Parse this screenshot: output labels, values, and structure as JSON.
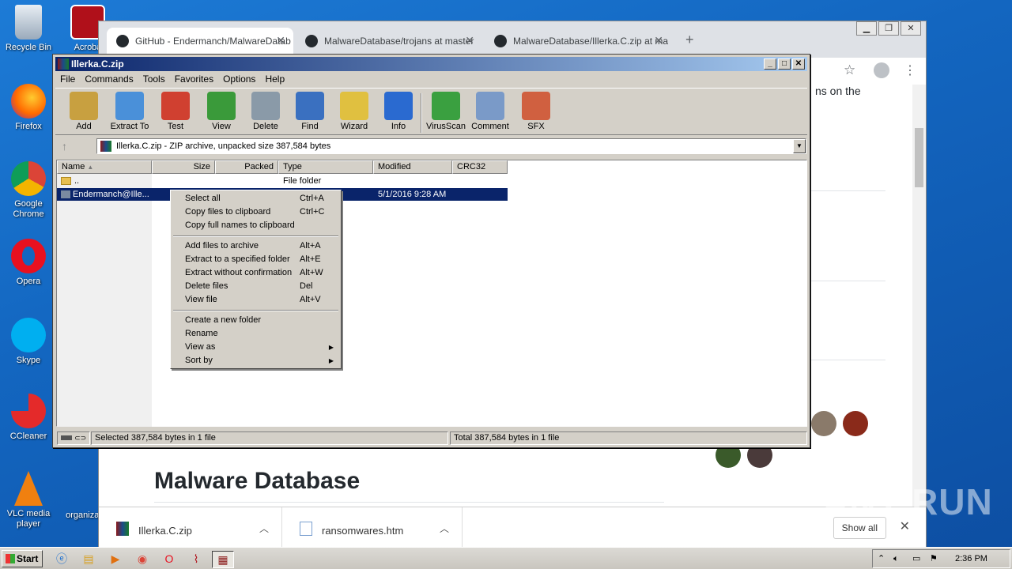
{
  "desktop": {
    "icons": [
      {
        "label": "Recycle Bin"
      },
      {
        "label": "Acroba"
      },
      {
        "label": "Firefox"
      },
      {
        "label": "Google Chrome"
      },
      {
        "label": "Opera"
      },
      {
        "label": "Skype"
      },
      {
        "label": "CCleaner"
      },
      {
        "label": "VLC media player"
      },
      {
        "label": "organizati"
      }
    ]
  },
  "chrome": {
    "tabs": [
      {
        "label": "GitHub - Endermanch/MalwareDatab"
      },
      {
        "label": "MalwareDatabase/trojans at master"
      },
      {
        "label": "MalwareDatabase/Illerka.C.zip at ma"
      }
    ],
    "page_heading": "Malware Database",
    "page_fragment": "ns on the",
    "downloads": [
      {
        "name": "Illerka.C.zip"
      },
      {
        "name": "ransomwares.htm"
      }
    ],
    "show_all": "Show all"
  },
  "winrar": {
    "title": "Illerka.C.zip",
    "menu": [
      "File",
      "Commands",
      "Tools",
      "Favorites",
      "Options",
      "Help"
    ],
    "toolbar": [
      {
        "label": "Add",
        "icon": "add-icon",
        "color": "#c8a040"
      },
      {
        "label": "Extract To",
        "icon": "extract-folder-icon",
        "color": "#4a90d9"
      },
      {
        "label": "Test",
        "icon": "test-checklist-icon",
        "color": "#d04030"
      },
      {
        "label": "View",
        "icon": "book-icon",
        "color": "#3a9a3a"
      },
      {
        "label": "Delete",
        "icon": "trash-icon",
        "color": "#8a9aa8"
      },
      {
        "label": "Find",
        "icon": "magnifier-icon",
        "color": "#3a70c0"
      },
      {
        "label": "Wizard",
        "icon": "wand-icon",
        "color": "#e0c040"
      },
      {
        "label": "Info",
        "icon": "info-icon",
        "color": "#2a6ad0"
      },
      {
        "label": "VirusScan",
        "icon": "virus-scan-icon",
        "color": "#3aa040"
      },
      {
        "label": "Comment",
        "icon": "comment-icon",
        "color": "#7a9ac8"
      },
      {
        "label": "SFX",
        "icon": "sfx-icon",
        "color": "#d06040"
      }
    ],
    "address": "Illerka.C.zip - ZIP archive, unpacked size 387,584 bytes",
    "columns": [
      "Name",
      "Size",
      "Packed",
      "Type",
      "Modified",
      "CRC32"
    ],
    "rows": [
      {
        "name": "..",
        "size": "",
        "packed": "",
        "type": "File folder",
        "modified": "",
        "crc": ""
      },
      {
        "name": "Endermanch@Ille...",
        "size": "",
        "packed": "",
        "type": "",
        "modified": "5/1/2016 9:28 AM",
        "crc": ""
      }
    ],
    "status_left": "Selected 387,584 bytes in 1 file",
    "status_right": "Total 387,584 bytes in 1 file"
  },
  "context_menu": {
    "groups": [
      [
        {
          "label": "Select all",
          "shortcut": "Ctrl+A"
        },
        {
          "label": "Copy files to clipboard",
          "shortcut": "Ctrl+C"
        },
        {
          "label": "Copy full names to clipboard",
          "shortcut": ""
        }
      ],
      [
        {
          "label": "Add files to archive",
          "shortcut": "Alt+A"
        },
        {
          "label": "Extract to a specified folder",
          "shortcut": "Alt+E"
        },
        {
          "label": "Extract without confirmation",
          "shortcut": "Alt+W"
        },
        {
          "label": "Delete files",
          "shortcut": "Del"
        },
        {
          "label": "View file",
          "shortcut": "Alt+V"
        }
      ],
      [
        {
          "label": "Create a new folder",
          "shortcut": ""
        },
        {
          "label": "Rename",
          "shortcut": ""
        },
        {
          "label": "View as",
          "shortcut": "",
          "submenu": true
        },
        {
          "label": "Sort by",
          "shortcut": "",
          "submenu": true
        }
      ]
    ]
  },
  "taskbar": {
    "start": "Start",
    "time": "2:36 PM"
  },
  "watermark": "ANY RUN"
}
